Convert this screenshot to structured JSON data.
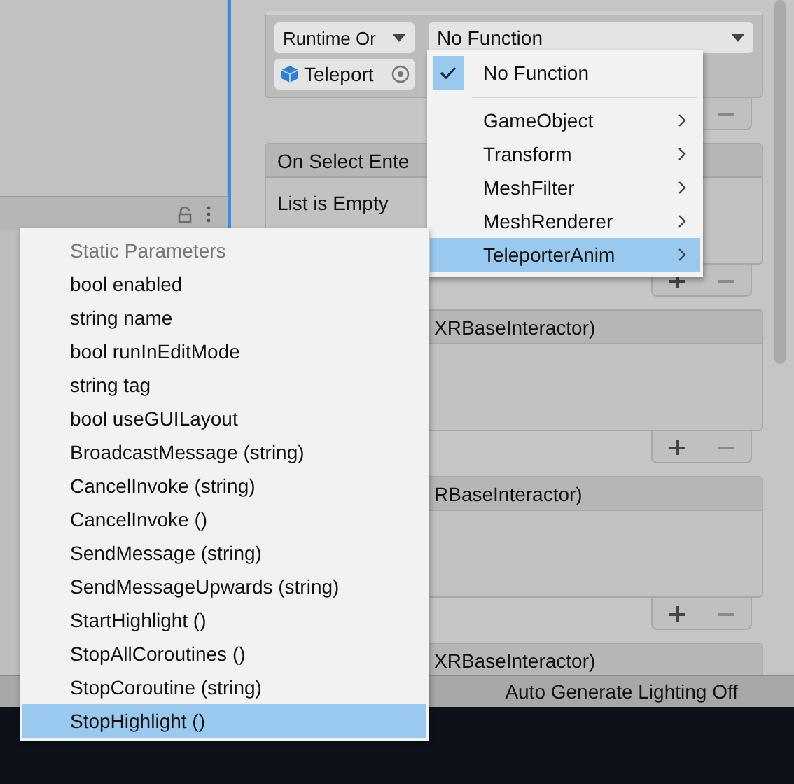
{
  "inspector": {
    "runtime_dropdown": "Runtime Or",
    "function_dropdown": "No Function",
    "object_field": "Teleport",
    "sections": [
      {
        "kind": "open",
        "title": "On Select Ente",
        "body": "List is Empty"
      },
      {
        "kind": "covered",
        "title": "XRBaseInteractor)"
      },
      {
        "kind": "covered",
        "title": "RBaseInteractor)"
      },
      {
        "kind": "covered",
        "title": "XRBaseInteractor)"
      }
    ]
  },
  "function_menu": {
    "items": [
      {
        "kind": "check",
        "label": "No Function",
        "checked": true
      },
      {
        "kind": "submenu",
        "label": "GameObject",
        "selected": false
      },
      {
        "kind": "submenu",
        "label": "Transform",
        "selected": false
      },
      {
        "kind": "submenu",
        "label": "MeshFilter",
        "selected": false
      },
      {
        "kind": "submenu",
        "label": "MeshRenderer",
        "selected": false
      },
      {
        "kind": "submenu",
        "label": "TeleporterAnim",
        "selected": true
      }
    ]
  },
  "method_menu": {
    "items": [
      {
        "kind": "header",
        "label": "Static Parameters"
      },
      {
        "kind": "item",
        "label": "bool enabled",
        "selected": false
      },
      {
        "kind": "item",
        "label": "string name",
        "selected": false
      },
      {
        "kind": "item",
        "label": "bool runInEditMode",
        "selected": false
      },
      {
        "kind": "item",
        "label": "string tag",
        "selected": false
      },
      {
        "kind": "item",
        "label": "bool useGUILayout",
        "selected": false
      },
      {
        "kind": "item",
        "label": "BroadcastMessage (string)",
        "selected": false
      },
      {
        "kind": "item",
        "label": "CancelInvoke (string)",
        "selected": false
      },
      {
        "kind": "item",
        "label": "CancelInvoke ()",
        "selected": false
      },
      {
        "kind": "item",
        "label": "SendMessage (string)",
        "selected": false
      },
      {
        "kind": "item",
        "label": "SendMessageUpwards (string)",
        "selected": false
      },
      {
        "kind": "item",
        "label": "StartHighlight ()",
        "selected": false
      },
      {
        "kind": "item",
        "label": "StopAllCoroutines ()",
        "selected": false
      },
      {
        "kind": "item",
        "label": "StopCoroutine (string)",
        "selected": false
      },
      {
        "kind": "item",
        "label": "StopHighlight ()",
        "selected": true
      }
    ]
  },
  "status_bar": {
    "text": "Auto Generate Lighting Off"
  }
}
